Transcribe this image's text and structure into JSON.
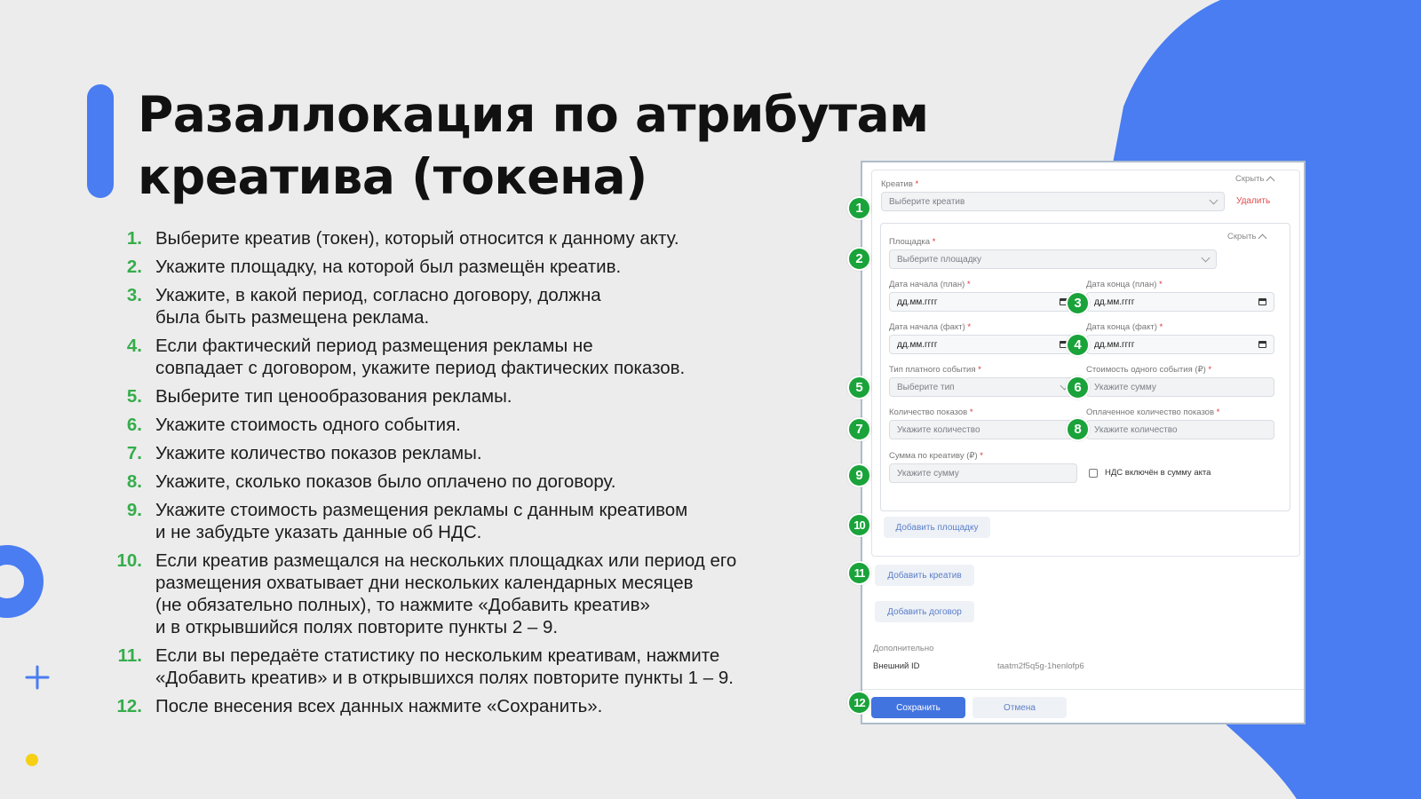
{
  "title": {
    "line1": "Разаллокация по атрибутам",
    "line2": "креатива (токена)"
  },
  "steps": [
    {
      "num": "1.",
      "lines": [
        "Выберите креатив (токен), который относится к данному акту."
      ]
    },
    {
      "num": "2.",
      "lines": [
        "Укажите площадку, на которой был размещён креатив."
      ]
    },
    {
      "num": "3.",
      "lines": [
        "Укажите, в какой период, согласно договору, должна",
        "была быть размещена реклама."
      ]
    },
    {
      "num": "4.",
      "lines": [
        "Если фактический период размещения рекламы не",
        "совпадает с договором, укажите период фактических показов."
      ]
    },
    {
      "num": "5.",
      "lines": [
        "Выберите тип ценообразования рекламы."
      ]
    },
    {
      "num": "6.",
      "lines": [
        "Укажите стоимость одного события."
      ]
    },
    {
      "num": "7.",
      "lines": [
        "Укажите количество показов рекламы."
      ]
    },
    {
      "num": "8.",
      "lines": [
        "Укажите, сколько показов было оплачено по договору."
      ]
    },
    {
      "num": "9.",
      "lines": [
        "Укажите стоимость размещения рекламы с данным креативом",
        "и не забудьте указать данные об НДС."
      ]
    },
    {
      "num": "10.",
      "lines": [
        "Если креатив размещался на нескольких площадках или период его",
        "размещения охватывает дни нескольких календарных месяцев",
        "(не обязательно полных), то нажмите «Добавить креатив»",
        "и в открывшийся полях повторите пункты 2 – 9."
      ]
    },
    {
      "num": "11.",
      "lines": [
        "Если вы передаёте статистику по нескольким креативам, нажмите",
        "«Добавить креатив» и в открывшихся полях повторите пункты 1 – 9."
      ]
    },
    {
      "num": "12.",
      "lines": [
        "После внесения всех данных нажмите «Сохранить»."
      ]
    }
  ],
  "form": {
    "creative_label": "Креатив",
    "required_mark": "*",
    "hide_label": "Скрыть",
    "creative_placeholder": "Выберите креатив",
    "delete_label": "Удалить",
    "site_label": "Площадка",
    "site_placeholder": "Выберите площадку",
    "plan_start_label": "Дата начала (план)",
    "plan_end_label": "Дата конца (план)",
    "fact_start_label": "Дата начала (факт)",
    "fact_end_label": "Дата конца (факт)",
    "date_placeholder": "дд.мм.гггг",
    "event_type_label": "Тип платного события",
    "event_type_placeholder": "Выберите тип",
    "event_cost_label": "Стоимость одного события (₽)",
    "sum_placeholder": "Укажите сумму",
    "impressions_label": "Количество показов",
    "paid_impressions_label": "Оплаченное количество показов",
    "qty_placeholder": "Укажите количество",
    "creative_sum_label": "Сумма по креативу (₽)",
    "vat_label": "НДС включён в сумму акта",
    "add_site_button": "Добавить площадку",
    "add_creative_button": "Добавить креатив",
    "add_contract_button": "Добавить договор",
    "additional_label": "Дополнительно",
    "external_id_label": "Внешний ID",
    "external_id_value": "taatm2f5q5g-1henlofp6",
    "save_button": "Сохранить",
    "cancel_button": "Отмена"
  },
  "badges": [
    "1",
    "2",
    "3",
    "4",
    "5",
    "6",
    "7",
    "8",
    "9",
    "10",
    "11",
    "12"
  ],
  "colors": {
    "accent_blue": "#4a7cf2",
    "step_green": "#35ad4b",
    "badge_green": "#1aa33a",
    "primary_button": "#4274e0",
    "delete_red": "#e14b4b"
  }
}
